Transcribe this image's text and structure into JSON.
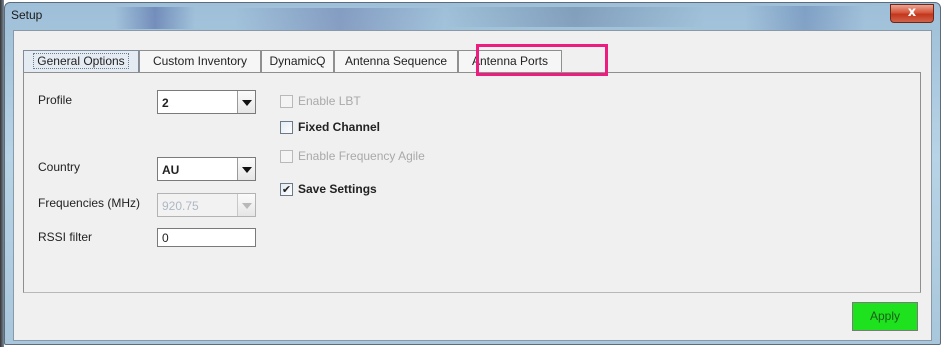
{
  "window": {
    "title": "Setup",
    "close_glyph": "x"
  },
  "tabs": [
    {
      "label": "General Options",
      "active": true
    },
    {
      "label": "Custom Inventory",
      "active": false
    },
    {
      "label": "DynamicQ",
      "active": false
    },
    {
      "label": "Antenna Sequence",
      "active": false
    },
    {
      "label": "Antenna Ports",
      "active": false,
      "highlighted": true
    }
  ],
  "general": {
    "profile": {
      "label": "Profile",
      "value": "2"
    },
    "country": {
      "label": "Country",
      "value": "AU"
    },
    "frequencies": {
      "label": "Frequencies (MHz)",
      "value": "920.75",
      "enabled": false
    },
    "rssi": {
      "label": "RSSI filter",
      "value": "0"
    }
  },
  "options": {
    "enable_lbt": {
      "label": "Enable LBT",
      "checked": false,
      "enabled": false
    },
    "fixed_channel": {
      "label": "Fixed Channel",
      "checked": false,
      "enabled": true
    },
    "freq_agile": {
      "label": "Enable Frequency Agile",
      "checked": false,
      "enabled": false
    },
    "save_settings": {
      "label": "Save Settings",
      "checked": true,
      "enabled": true,
      "check_glyph": "✔"
    }
  },
  "apply": {
    "label": "Apply"
  },
  "colors": {
    "highlight": "#ec1d7e",
    "apply_bg": "#1ee21e"
  },
  "icons": [
    "close-icon",
    "dropdown-arrow-icon",
    "checkmark-icon"
  ]
}
